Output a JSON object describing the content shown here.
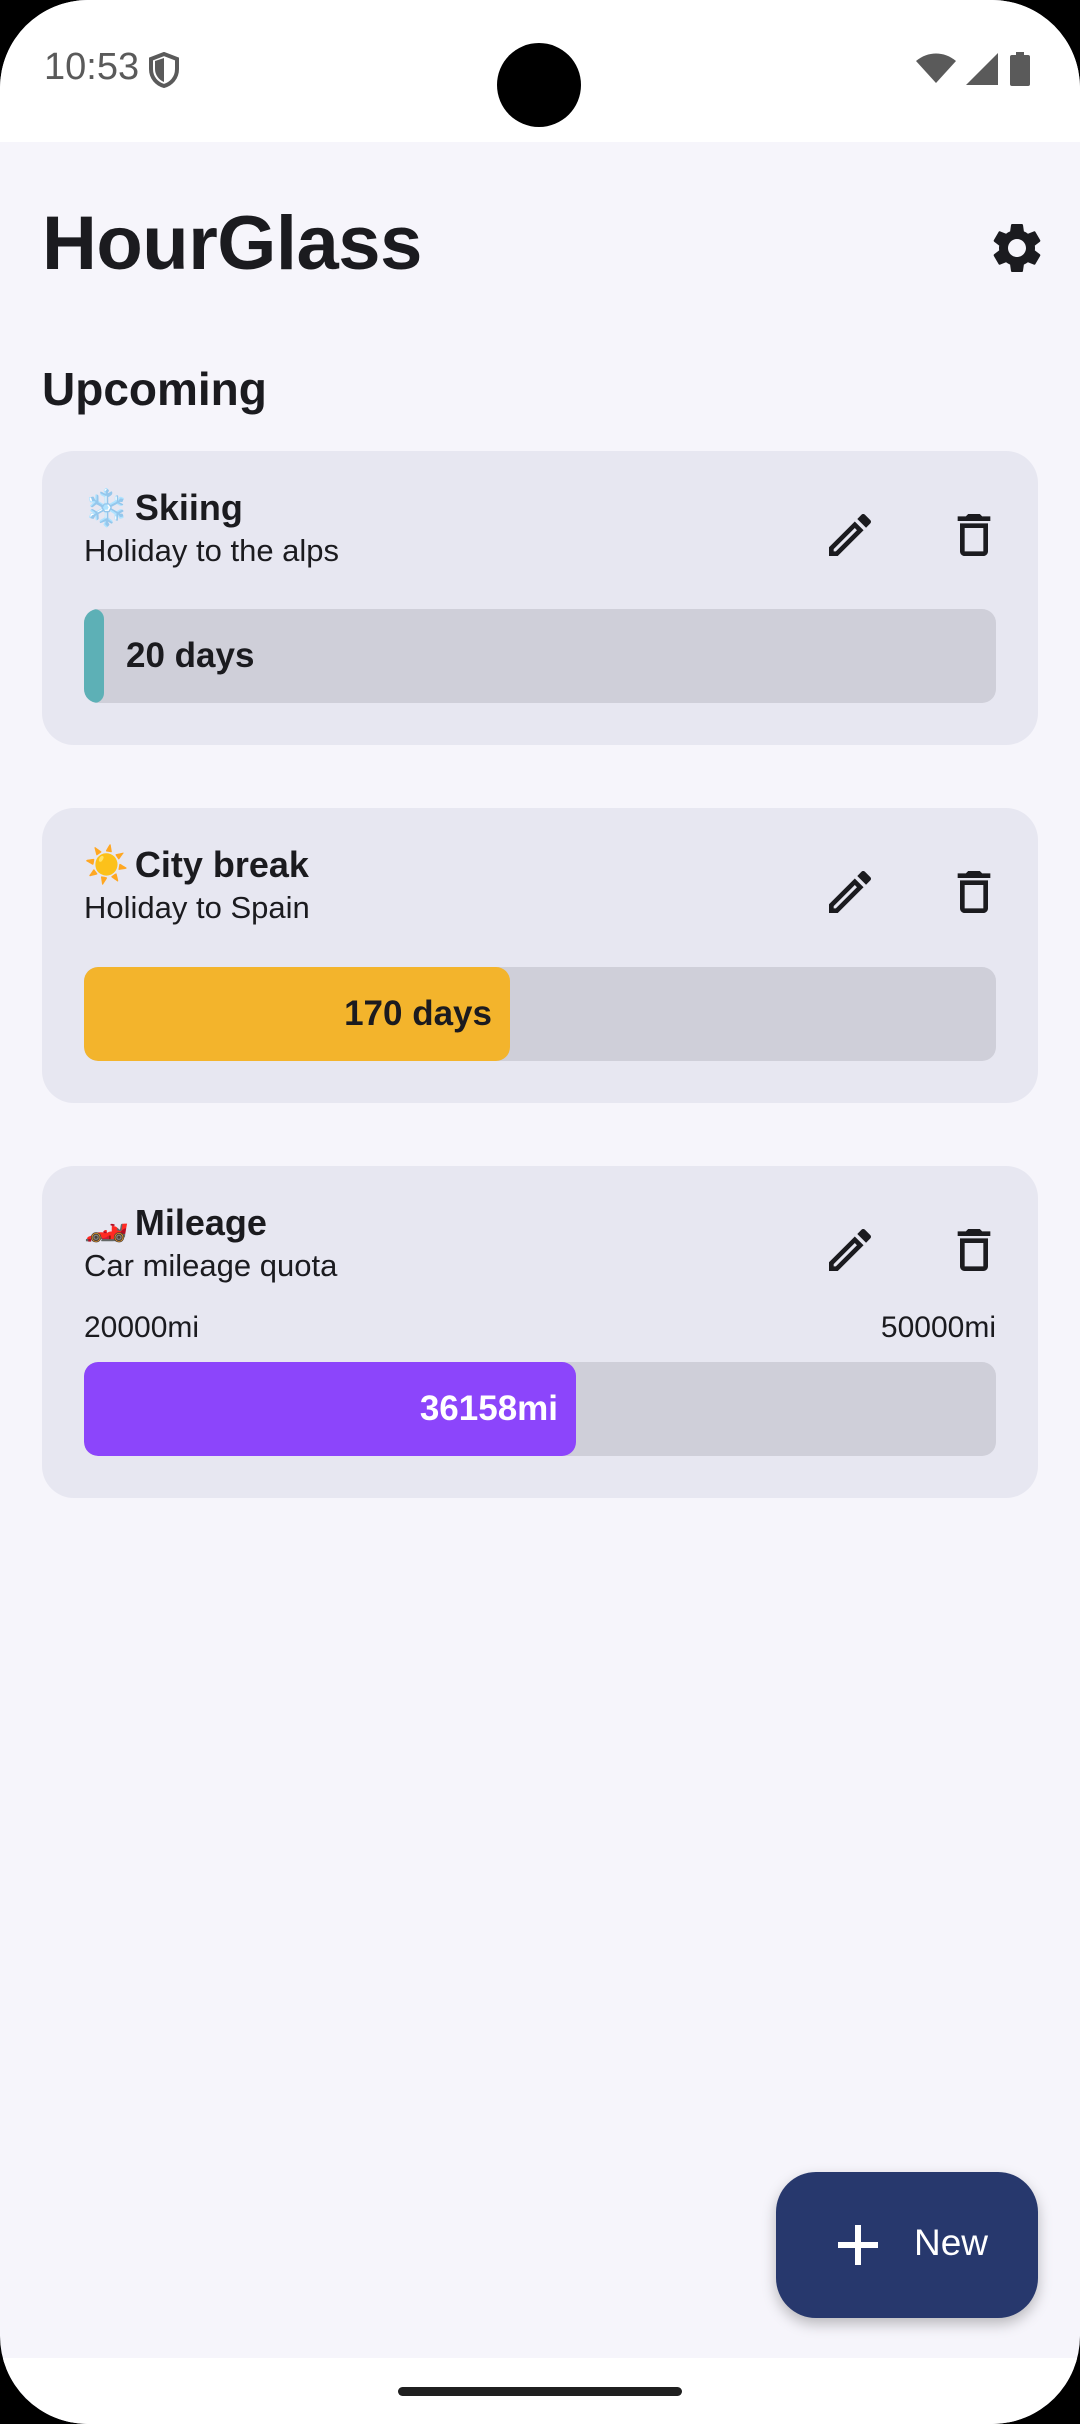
{
  "status_bar": {
    "time": "10:53",
    "icons": [
      "shield-icon",
      "wifi-icon",
      "signal-icon",
      "battery-icon"
    ]
  },
  "header": {
    "title": "HourGlass",
    "settings_icon": "gear-icon"
  },
  "section": {
    "title": "Upcoming"
  },
  "cards": [
    {
      "emoji": "❄️",
      "title": "Skiing",
      "subtitle": "Holiday to the alps",
      "progress_label": "20 days",
      "progress_fraction": 0.02,
      "bar_color": "#5db0b6",
      "label_color": "#1b1b1f"
    },
    {
      "emoji": "☀️",
      "title": "City break",
      "subtitle": "Holiday to Spain",
      "progress_label": "170 days",
      "progress_fraction": 0.467,
      "bar_color": "#f3b42c",
      "label_color": "#1b1b1f"
    },
    {
      "emoji": "🏎️",
      "title": "Mileage",
      "subtitle": "Car mileage quota",
      "range_min": "20000mi",
      "range_max": "50000mi",
      "progress_label": "36158mi",
      "progress_fraction": 0.539,
      "bar_color": "#8c45fb",
      "label_color": "#ffffff"
    }
  ],
  "card_actions": {
    "edit_icon": "pencil-icon",
    "delete_icon": "trash-icon"
  },
  "fab": {
    "icon": "plus-icon",
    "label": "New"
  },
  "colors": {
    "background": "#f6f5fb",
    "card": "#e7e7f1",
    "track": "#cfcfd9",
    "fab": "#27386d"
  }
}
